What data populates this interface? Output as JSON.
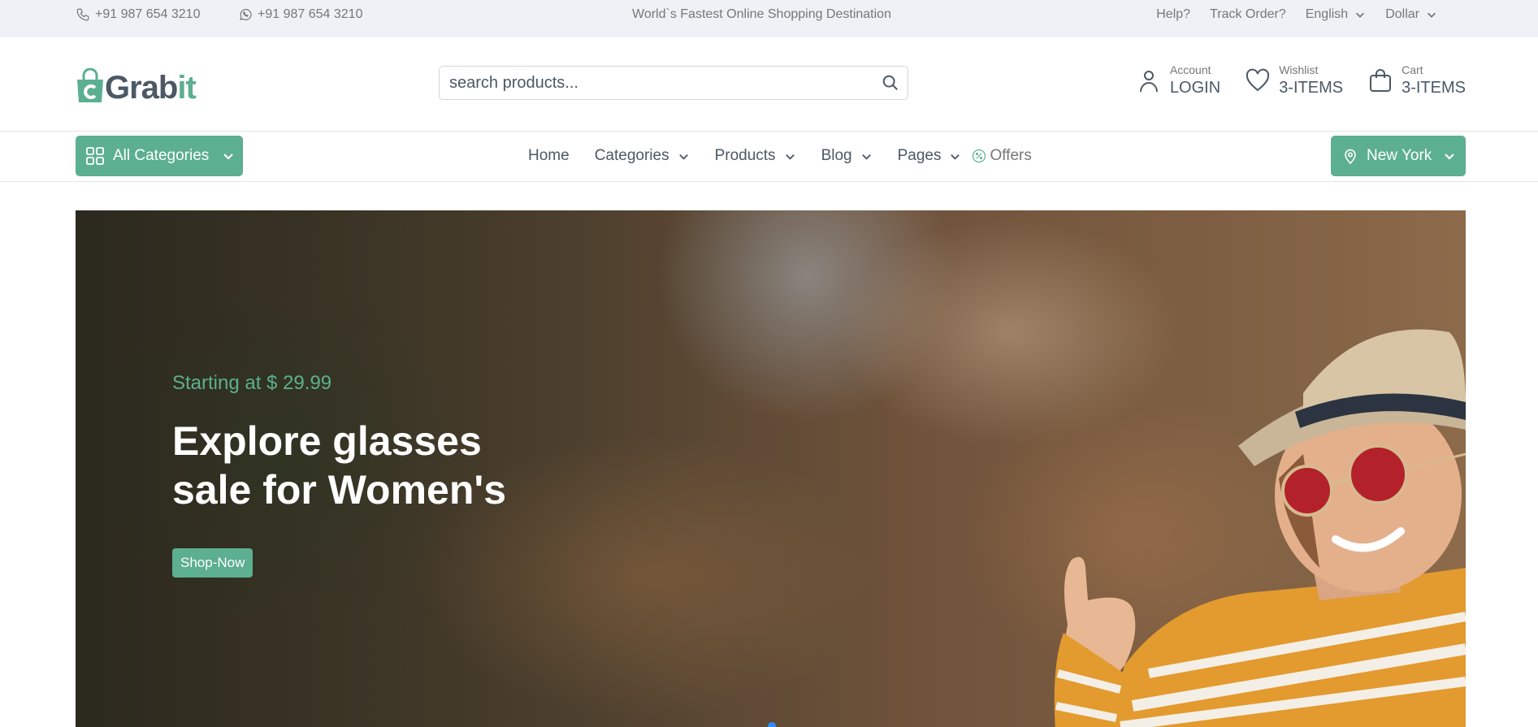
{
  "topbar": {
    "phone": "+91 987 654 3210",
    "whatsapp": "+91 987 654 3210",
    "tagline": "World`s Fastest Online Shopping Destination",
    "help": "Help?",
    "track": "Track Order?",
    "language": "English",
    "currency": "Dollar"
  },
  "header": {
    "logo_main": "Grab",
    "logo_accent": "it",
    "search_placeholder": "search products...",
    "account": {
      "label": "Account",
      "value": "LOGIN"
    },
    "wishlist": {
      "label": "Wishlist",
      "value": "3-ITEMS"
    },
    "cart": {
      "label": "Cart",
      "value": "3-ITEMS"
    }
  },
  "nav": {
    "all_categories": "All Categories",
    "items": [
      "Home",
      "Categories",
      "Products",
      "Blog",
      "Pages"
    ],
    "offers": "Offers",
    "location": "New York"
  },
  "hero": {
    "starting": "Starting at $ 29.99",
    "title_line1": "Explore glasses",
    "title_line2": "sale for Women's",
    "button": "Shop-Now"
  },
  "colors": {
    "accent": "#5caf90",
    "text": "#4b5966",
    "topbar_bg": "#f0f1f6"
  }
}
